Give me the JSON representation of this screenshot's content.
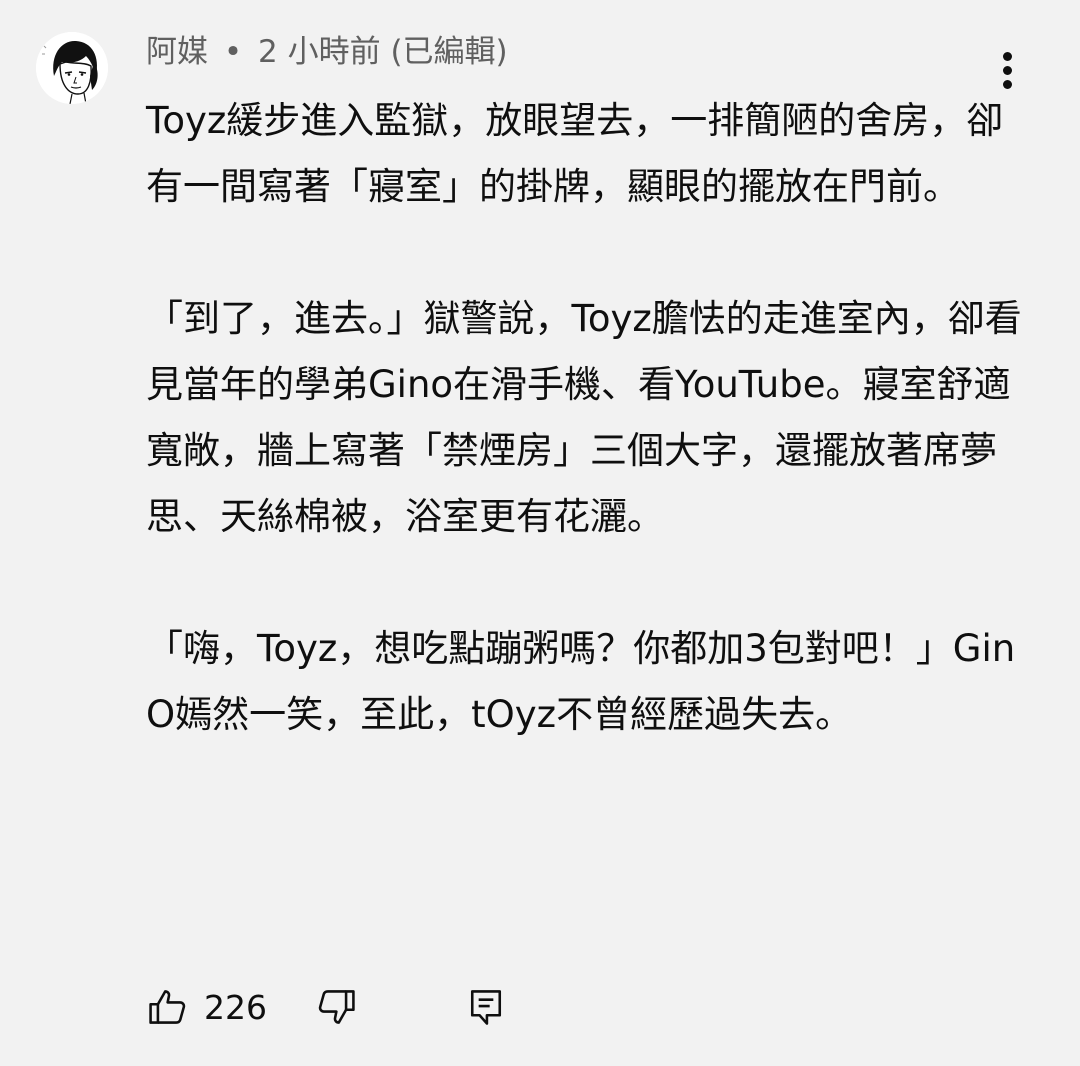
{
  "comment": {
    "author": "阿媒",
    "separator": "•",
    "time": "2 小時前",
    "edited": "(已編輯)",
    "paragraphs": [
      "Toyz緩步進入監獄，放眼望去，一排簡陋的舍房，卻有一間寫著「寢室」的掛牌，顯眼的擺放在門前。",
      "「到了，進去。」獄警說，Toyz膽怯的走進室內，卻看見當年的學弟Gino在滑手機、看YouTube。寢室舒適寬敞，牆上寫著「禁煙房」三個大字，還擺放著席夢思、天絲棉被，浴室更有花灑。",
      "「嗨，Toyz，想吃點蹦粥嗎？你都加3包對吧！」GinO嫣然一笑，至此，tOyz不曾經歷過失去。"
    ],
    "likes": "226",
    "icons": {
      "avatar": "avatar-portrait",
      "more": "more-vert-icon",
      "like": "thumbs-up-icon",
      "dislike": "thumbs-down-icon",
      "reply": "reply-comment-icon"
    }
  }
}
